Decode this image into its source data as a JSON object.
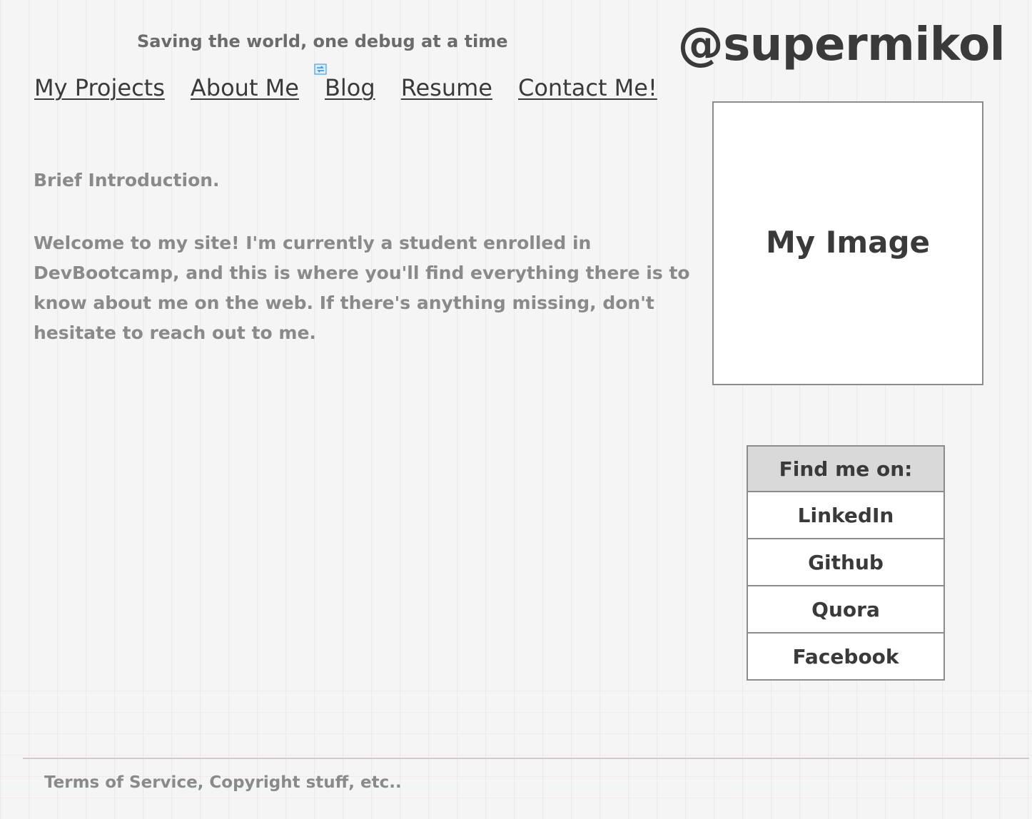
{
  "header": {
    "tagline": "Saving the world, one debug at a time",
    "handle": "@supermikol"
  },
  "nav": {
    "items": [
      {
        "label": "My Projects"
      },
      {
        "label": "About Me"
      },
      {
        "label": "Blog"
      },
      {
        "label": "Resume"
      },
      {
        "label": "Contact Me!"
      }
    ]
  },
  "main": {
    "intro_title": "Brief Introduction.",
    "intro_body": "Welcome to my site! I'm currently a student enrolled in DevBootcamp, and this is where you'll find everything there is to know about me on the web. If there's anything missing, don't hesitate to reach out to me."
  },
  "sidebar": {
    "image_placeholder": "My Image",
    "social_heading": "Find me on:",
    "social_links": [
      {
        "label": "LinkedIn"
      },
      {
        "label": "Github"
      },
      {
        "label": "Quora"
      },
      {
        "label": "Facebook"
      }
    ]
  },
  "footer": {
    "text": "Terms of Service, Copyright stuff, etc.."
  },
  "icons": {
    "refresh": "refresh-icon"
  },
  "colors": {
    "background": "#f5f5f5",
    "text_dark": "#3a3a3a",
    "text_muted": "#8a8a8a",
    "border": "#8c8c8c",
    "social_header_bg": "#d9d9d9",
    "refresh_icon": "#2f8fe0"
  }
}
